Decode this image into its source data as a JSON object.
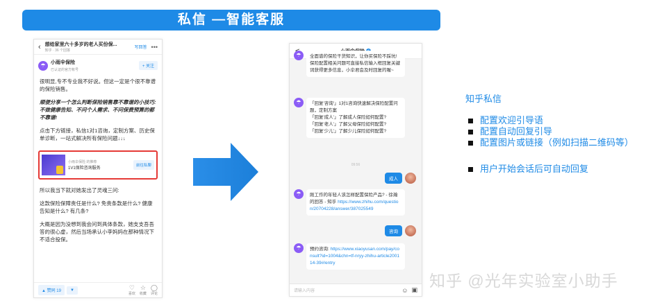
{
  "banner": {
    "title": "私信 —智能客服"
  },
  "phone1": {
    "header": {
      "title": "想给家里六十多岁的老人买份保...",
      "subtitle": "知乎 · 36 个回答",
      "write_label": "写回答",
      "more_label": "•••"
    },
    "author": {
      "name": "小雨伞保险",
      "desc": "已认证的官方帐号",
      "follow_label": "+ 关注"
    },
    "paragraphs": [
      "很明显,专不专业我不好说。但这一定是个很不靠谱的保险销售。",
      "顺便分享一个怎么判断保险销售靠不靠谱的小技巧: 不做健康告知、不问个人需求、不问保费预算的都不靠谱!",
      "点击下方链接，私信1对1咨询，定制方案、历史保单诊断，一站式解决所有保险问题↓↓↓"
    ],
    "ad": {
      "source": "小雨伞保险 的推荐",
      "service": "1V1保险咨询服务",
      "button_label": "前往私聊"
    },
    "paragraphs2": [
      "所以我当下就对她发出了灵魂三问:",
      "这款保险保障责任是什么? 免责条款是什么? 健康告知是什么? 有几条?",
      "大概是因为没想到我会问到具体条款，她支支吾吾答的很心虚，然后当场承认小李妈妈在那种情况下不适合投保。"
    ],
    "bottom": {
      "vote_up_label": "▲ 赞同 19",
      "vote_down_label": "▼",
      "actions": [
        {
          "icon": "heart-icon",
          "glyph": "♡",
          "label": "喜欢"
        },
        {
          "icon": "star-icon",
          "glyph": "☆",
          "label": "收藏"
        },
        {
          "icon": "comment-icon",
          "glyph": "◯",
          "label": "评论"
        }
      ]
    }
  },
  "phone2": {
    "header": {
      "back": "<",
      "name": "小雨伞保险"
    },
    "msg1": "全面谱的保险干货知识，让你买保险不踩坑!\n保险配置相关问题可直接私信输入框回复关键词获得更多信息，小伞君会及时回复的喔~",
    "msg2": "「回复'咨询'」1对1咨询快速解决保险配置问题，定制方案\n「回复'成人'」了解成人保险如何配置?\n「回复'老人'」了解父母保险如何配置?\n「回复'少儿'」了解少儿保险如何配置?",
    "time_label": "09:56",
    "user_msg1": "成人",
    "msg3_text": "刚工作的年轻人该怎样配置保险产品? - 徐瀚的回答 - 知乎 ",
    "msg3_link": "https://www.zhihu.com/question/20704228/answer/387025549",
    "user_msg2": "咨询",
    "msg4_text": "预约咨询: ",
    "msg4_link": "https://www.xiaoyusan.com/pay/consult?id=1004&chn=tf-nryy-zhihu-article200114-39#/entry",
    "input_placeholder": "请输入内容"
  },
  "panel": {
    "title": "知乎私信",
    "items": [
      "配置欢迎引导语",
      "配置自动回复引导",
      "配置图片或链接（例如扫描二维码等）"
    ],
    "items2": [
      "用户开始会话后可自动回复"
    ]
  },
  "watermark": "知乎 @光年实验室小助手",
  "colors": {
    "accent": "#1e8ae6",
    "highlight_border": "#e53935",
    "avatar": "#8b5cf6"
  }
}
